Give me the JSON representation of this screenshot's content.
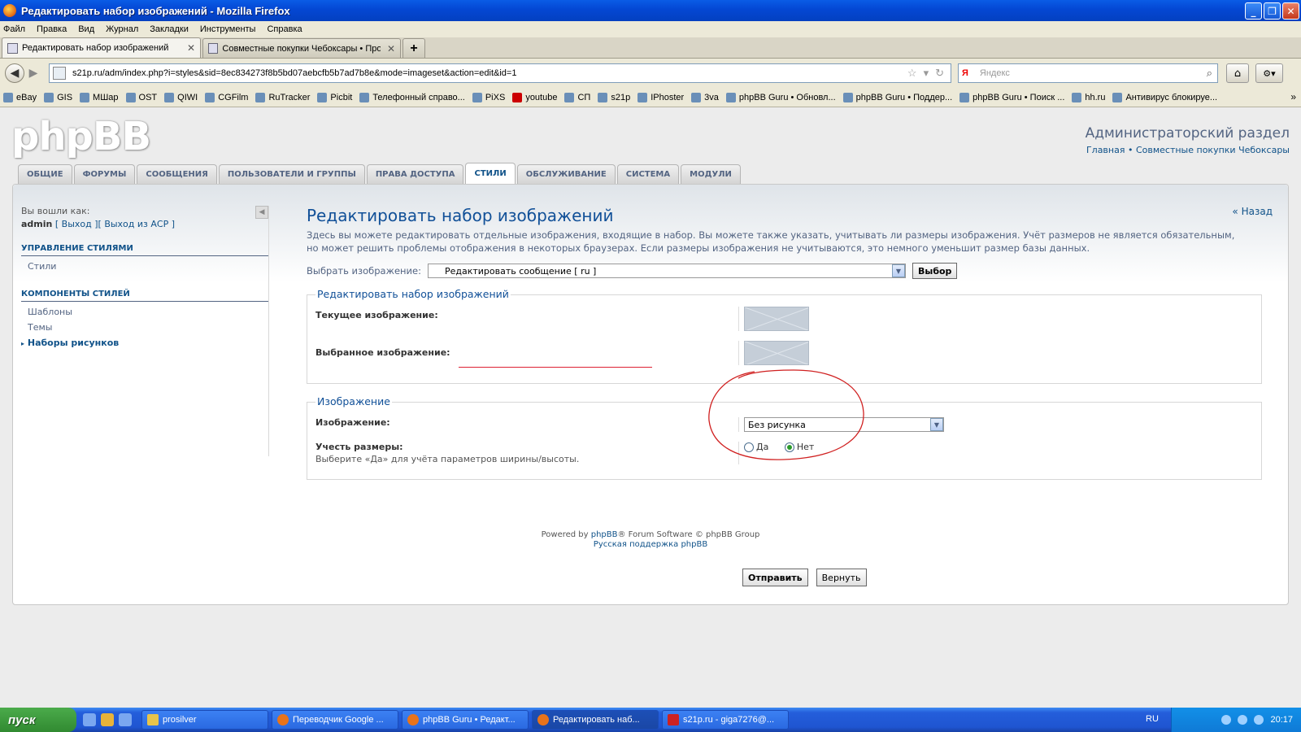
{
  "window": {
    "title": "Редактировать набор изображений - Mozilla Firefox"
  },
  "menu": [
    "Файл",
    "Правка",
    "Вид",
    "Журнал",
    "Закладки",
    "Инструменты",
    "Справка"
  ],
  "tabs": [
    {
      "label": "Редактировать набор изображений"
    },
    {
      "label": "Совместные покупки Чебоксары • Про..."
    }
  ],
  "nav": {
    "url": "s21p.ru/adm/index.php?i=styles&sid=8ec834273f8b5bd07aebcfb5b7ad7b8e&mode=imageset&action=edit&id=1",
    "search_engine": "Я",
    "search_placeholder": "Яндекс"
  },
  "bookmarks": [
    "eBay",
    "GIS",
    "МШар",
    "OST",
    "QIWI",
    "CGFilm",
    "RuTracker",
    "Picbit",
    "Телефонный справо...",
    "PiXS",
    "youtube",
    "СП",
    "s21p",
    "IPhoster",
    "3va",
    "phpBB Guru • Обновл...",
    "phpBB Guru • Поддер...",
    "phpBB Guru • Поиск ...",
    "hh.ru",
    "Антивирус блокируе..."
  ],
  "header": {
    "logo": "phpBB",
    "title": "Администраторский раздел",
    "link_home": "Главная",
    "sep": " • ",
    "link_forum": "Совместные покупки Чебоксары"
  },
  "acp_tabs": [
    "Общие",
    "Форумы",
    "Сообщения",
    "Пользователи и группы",
    "Права доступа",
    "Стили",
    "Обслуживание",
    "Система",
    "Модули"
  ],
  "sidebar": {
    "logged_in_label": "Вы вошли как:",
    "username": "admin",
    "logout": "[ Выход ]",
    "logout_acp": "[ Выход из АСР ]",
    "section1": "Управление стилями",
    "section1_items": [
      "Стили"
    ],
    "section2": "Компоненты стилей",
    "section2_items": [
      "Шаблоны",
      "Темы",
      "Наборы рисунков"
    ]
  },
  "main": {
    "back": "« Назад",
    "title": "Редактировать набор изображений",
    "intro": "Здесь вы можете редактировать отдельные изображения, входящие в набор. Вы можете также указать, учитывать ли размеры изображения. Учёт размеров не является обязательным, но может решить проблемы отображения в некоторых браузерах. Если размеры изображения не учитываются, это немного уменьшит размер базы данных.",
    "select_label": "Выбрать изображение:",
    "select_value": "Редактировать сообщение [ ru ]",
    "select_button": "Выбор",
    "fs1_legend": "Редактировать набор изображений",
    "current_label": "Текущее изображение:",
    "selected_label": "Выбранное изображение:",
    "fs2_legend": "Изображение",
    "image_label": "Изображение:",
    "image_value": "Без рисунка",
    "sizes_label": "Учесть размеры:",
    "sizes_hint": "Выберите «Да» для учёта параметров ширины/высоты.",
    "yes": "Да",
    "no": "Нет",
    "submit": "Отправить",
    "reset": "Вернуть"
  },
  "footer": {
    "powered_prefix": "Powered by ",
    "powered_link": "phpBB",
    "powered_suffix": "® Forum Software © phpBB Group",
    "support": "Русская поддержка phpBB"
  },
  "taskbar": {
    "start": "пуск",
    "tasks": [
      "prosilver",
      "Переводчик Google ...",
      "phpBB Guru • Редакт...",
      "Редактировать наб...",
      "s21p.ru - giga7276@..."
    ],
    "lang": "RU",
    "time": "20:17"
  }
}
